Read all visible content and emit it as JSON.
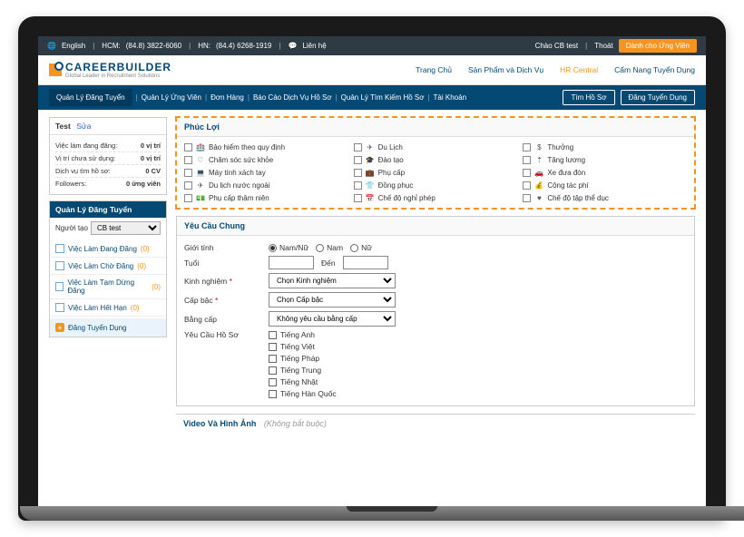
{
  "topbar": {
    "lang": "English",
    "hcm_lbl": "HCM:",
    "hcm": "(84.8) 3822-6060",
    "hn_lbl": "HN:",
    "hn": "(84.4) 6268-1919",
    "contact": "Liên hệ",
    "hello": "Chào CB test",
    "logout": "Thoát",
    "candidate_btn": "Dành cho Ứng Viên"
  },
  "logo": {
    "name": "CAREERBUILDER",
    "tagline": "Global Leader in Recruitment Solutions"
  },
  "nav": {
    "home": "Trang Chủ",
    "products": "Sản Phẩm và Dịch Vụ",
    "hr": "HR Central",
    "guide": "Cẩm Nang Tuyển Dụng"
  },
  "subnav": {
    "posting": "Quản Lý Đăng Tuyển",
    "applicants": "Quản Lý Ứng Viên",
    "orders": "Đơn Hàng",
    "reports": "Báo Cáo Dịch Vụ Hồ Sơ",
    "search": "Quản Lý Tìm Kiếm Hồ Sơ",
    "account": "Tài Khoản",
    "btn1": "Tìm Hồ Sơ",
    "btn2": "Đăng Tuyển Dụng"
  },
  "test_panel": {
    "title": "Test",
    "edit": "Sửa",
    "rows": [
      {
        "l": "Việc làm đang đăng:",
        "v": "0 vị trí"
      },
      {
        "l": "Vị trí chưa sử dụng:",
        "v": "0 vị trí"
      },
      {
        "l": "Dịch vụ tìm hồ sơ:",
        "v": "0 CV"
      },
      {
        "l": "Followers:",
        "v": "0 ứng viên"
      }
    ]
  },
  "manage_panel": {
    "title": "Quản Lý Đăng Tuyển",
    "label": "Người tạo",
    "select": "CB test",
    "items": [
      {
        "t": "Việc Làm Đang Đăng",
        "c": "(0)"
      },
      {
        "t": "Việc Làm Chờ Đăng",
        "c": "(0)"
      },
      {
        "t": "Việc Làm Tạm Dừng Đăng",
        "c": "(0)"
      },
      {
        "t": "Việc Làm Hết Hạn",
        "c": "(0)"
      }
    ],
    "action": "Đăng Tuyển Dụng"
  },
  "benefits": {
    "title": "Phúc Lợi",
    "items": [
      {
        "i": "🏥",
        "t": "Bảo hiểm theo quy định"
      },
      {
        "i": "✈",
        "t": "Du Lịch"
      },
      {
        "i": "$",
        "t": "Thưởng"
      },
      {
        "i": "♡",
        "t": "Chăm sóc sức khỏe"
      },
      {
        "i": "🎓",
        "t": "Đào tạo"
      },
      {
        "i": "⇡",
        "t": "Tăng lương"
      },
      {
        "i": "💻",
        "t": "Máy tính xách tay"
      },
      {
        "i": "💼",
        "t": "Phụ cấp"
      },
      {
        "i": "🚗",
        "t": "Xe đưa đón"
      },
      {
        "i": "✈",
        "t": "Du lịch nước ngoài"
      },
      {
        "i": "👕",
        "t": "Đồng phục"
      },
      {
        "i": "💰",
        "t": "Công tác phí"
      },
      {
        "i": "💵",
        "t": "Phụ cấp thâm niên"
      },
      {
        "i": "📅",
        "t": "Chế độ nghỉ phép"
      },
      {
        "i": "♥",
        "t": "Chế độ tập thể dục"
      }
    ]
  },
  "general": {
    "title": "Yêu Cầu Chung",
    "gender_lbl": "Giới tính",
    "gender_opts": {
      "a": "Nam/Nữ",
      "b": "Nam",
      "c": "Nữ"
    },
    "age_lbl": "Tuổi",
    "age_to": "Đến",
    "exp_lbl": "Kinh nghiệm",
    "exp_ph": "Chọn Kinh nghiệm",
    "level_lbl": "Cấp bậc",
    "level_ph": "Chọn Cấp bậc",
    "degree_lbl": "Bằng cấp",
    "degree_ph": "Không yêu cầu bằng cấp",
    "resume_lbl": "Yêu Cầu Hồ Sơ",
    "langs": [
      "Tiếng Anh",
      "Tiếng Việt",
      "Tiếng Pháp",
      "Tiếng Trung",
      "Tiếng Nhật",
      "Tiếng Hàn Quốc"
    ]
  },
  "video": {
    "title": "Video Và Hình Ảnh",
    "opt": "(Không bắt buộc)"
  }
}
